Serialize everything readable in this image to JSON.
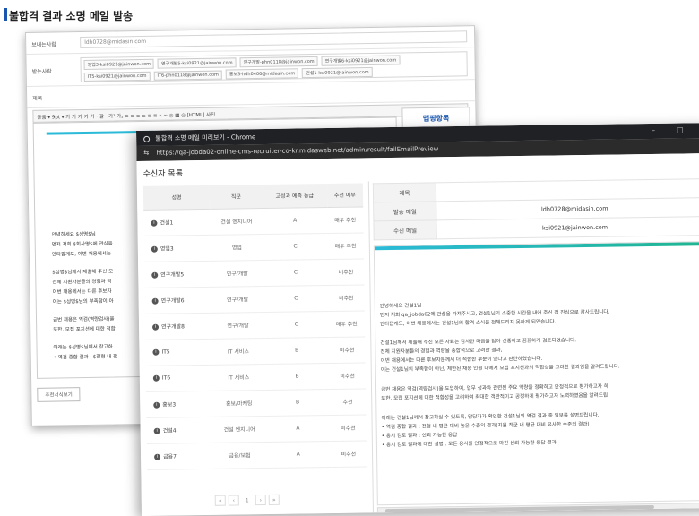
{
  "page": {
    "title": "불합격 결과 소명 메일 발송"
  },
  "back": {
    "sender_label": "보내는사람",
    "sender_value": "ldh0728@midasin.com",
    "recipients_label": "받는사람",
    "recipients": [
      "영업3-ksi0921@jainwon.com",
      "연구개발5-ksi0921@jainwon.com",
      "연구개발-phn0118@jainwon.com",
      "연구개발6-ksi0921@jainwon.com",
      "IT5-ksi0921@jainwon.com",
      "IT6-phn0118@jainwon.com",
      "홍보3-hdh0406@midasin.com",
      "건설1-ksi0921@jainwon.com"
    ],
    "subject_label": "제목",
    "toolbar_text": "돋움  ▾  9pt ▾  가  가  가  가  가 · 갈 · 가² 가₂  ≡ ≡ ≡ ≡ ≡ ≡  «  ∞  ◎  ▦  ◎  [HTML] 사진",
    "side_title": "맵핑항목",
    "editor_lines": [
      "안녕하세요 $성명$님",
      "먼저 저희 $회사명$에 관심을",
      "안타깝게도, 이번 채용에서는",
      "$성명$님께서 제출해 주신 모",
      "전체 지원자분들의 경험과 역",
      "이번 채용에서는 다른 후보자",
      "이는 $성명$님의 부족함이 아",
      "금번 채용은 역검(역량검사)을",
      "또한, 모집 포지션에 대한 적합",
      "아래는 $성명$님께서 참고하",
      "• 역검 종합 결과 : $전형 내 평"
    ],
    "preview_button": "추천서식보기"
  },
  "window": {
    "title": "불합격 소명 메일 미리보기 - Chrome",
    "url": "https://qa-jobda02-online-cms-recruiter-co-kr.midasweb.net/admin/result/failEmailPreview",
    "minimize": "–",
    "maximize": "□"
  },
  "recipients_list": {
    "title": "수신자 목록",
    "headers": [
      "성명",
      "직군",
      "고성과 예측 등급",
      "추천 여부"
    ],
    "rows": [
      {
        "name": "건설1",
        "job": "건설 엔지니어",
        "grade": "A",
        "recommend": "매우 추천"
      },
      {
        "name": "영업3",
        "job": "영업",
        "grade": "C",
        "recommend": "매우 추천"
      },
      {
        "name": "연구개발5",
        "job": "연구/개발",
        "grade": "C",
        "recommend": "비추천"
      },
      {
        "name": "연구개발6",
        "job": "연구/개발",
        "grade": "C",
        "recommend": "비추천"
      },
      {
        "name": "연구개발8",
        "job": "연구/개발",
        "grade": "C",
        "recommend": "매우 추천"
      },
      {
        "name": "IT5",
        "job": "IT 서비스",
        "grade": "B",
        "recommend": "비추천"
      },
      {
        "name": "IT6",
        "job": "IT 서비스",
        "grade": "B",
        "recommend": "비추천"
      },
      {
        "name": "홍보3",
        "job": "홍보/마케팅",
        "grade": "B",
        "recommend": "추천"
      },
      {
        "name": "건설4",
        "job": "건설 엔지니어",
        "grade": "A",
        "recommend": "비추천"
      },
      {
        "name": "금융7",
        "job": "금융/보험",
        "grade": "A",
        "recommend": "비추천"
      }
    ],
    "pager": {
      "first": "«",
      "prev": "‹",
      "page": "1",
      "next": "›",
      "last": "»"
    }
  },
  "mail_info": {
    "subject_label": "제목",
    "subject_value": "",
    "sender_label": "발송 메일",
    "sender_value": "ldh0728@midasin.com",
    "recipient_label": "수신 메일",
    "recipient_value": "ksi0921@jainwon.com"
  },
  "email_body": {
    "lines": [
      "안녕하세요 건설1님",
      "먼저 저희 qa_jobda02에 관심을 가져주시고, 건설1님의 소중한 시간을 내어 주신 점 진심으로 감사드립니다.",
      "안타깝게도, 이번 채용에서는 건설1님의 합격 소식을 전해드리지 못하게 되었습니다.",
      "건설1님께서 제출해 주신 모든 자료는 감사한 마음을 담아 신중하고 꼼꼼하게 검토되었습니다.",
      "전체 지원자분들의 경험과 역량을 종합적으로 고려한 결과,",
      "이번 채용에서는 다른 후보자분께서 더 적합한 부분이 있다고 판단하였습니다.",
      "이는 건설1님의 부족함이 아닌, 제한된 채용 인원 내에서 모집 포지션과의 적합성을 고려한 결과임을 알려드립니다.",
      "금번 채용은 역검(역량검사)을 도입하여, 업무 성과와 관련된 주요 역량을 정확하고 안정적으로 평가하고자 하",
      "또한, 모집 포지션에 대한 적합성을 고려하여 최대한 객관적이고 공정하게 평가하고자 노력하였음을 알려드립",
      "아래는 건설1님께서 참고하실 수 있도록, 담당자가 확인한 건설1님의 역검 결과 중 일부를 설명드립니다.",
      "• 역검 종합 결과 : 전형 내 평균 대비 높은 수준의 결과(지원 직군 내 평균 대비 유사한 수준의 결과)",
      "• 응시 검토 결과 : 신뢰 가능한 응답",
      "• 응시 검토 결과에 대한 설명 : 모든 응시를 안정적으로 마친 신뢰 가능한 응답 결과"
    ]
  }
}
